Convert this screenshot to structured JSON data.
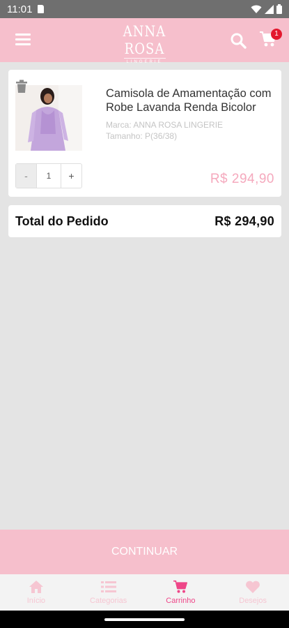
{
  "status_bar": {
    "time": "11:01"
  },
  "header": {
    "logo_name": "ANNA ROSA",
    "logo_sub": "LINGERIE",
    "cart_count": "1",
    "icons": [
      "menu-icon",
      "search-icon",
      "cart-icon"
    ]
  },
  "cart_item": {
    "title": "Camisola de Amamentação com Robe Lavanda Renda Bicolor",
    "brand": "Marca: ANNA ROSA LINGERIE",
    "size": "Tamanho: P(36/38)",
    "quantity": "1",
    "minus_label": "-",
    "plus_label": "+",
    "price": "R$  294,90"
  },
  "total": {
    "label": "Total do Pedido",
    "value": "R$  294,90"
  },
  "continue_label": "CONTINUAR",
  "tabs": [
    {
      "label": "Início",
      "icon": "home-icon"
    },
    {
      "label": "Categorias",
      "icon": "list-icon"
    },
    {
      "label": "Carrinho",
      "icon": "cart-icon",
      "active": true
    },
    {
      "label": "Desejos",
      "icon": "heart-icon"
    }
  ],
  "colors": {
    "brand_pink": "#f6bfcc",
    "active_tab": "#ee4688",
    "inactive_tab": "#f6c6d2",
    "price": "#f5a9bd",
    "badge": "#e3182e"
  }
}
